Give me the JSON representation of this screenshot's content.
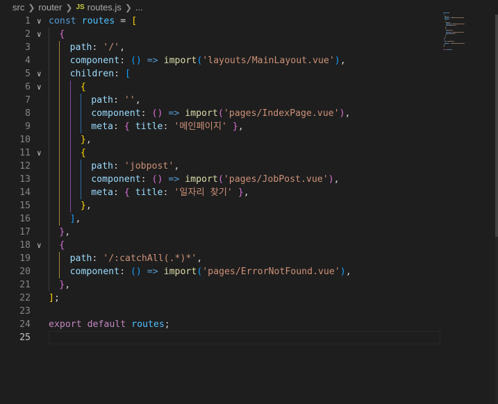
{
  "breadcrumb": {
    "parts": [
      "src",
      "router",
      "routes.js",
      "..."
    ],
    "file_icon": "JS"
  },
  "editor": {
    "language": "javascript",
    "current_line": 25,
    "folded_lines": [
      1,
      2,
      5,
      6,
      11,
      18
    ],
    "lines": [
      [
        [
          "kw",
          "const "
        ],
        [
          "var",
          "routes"
        ],
        [
          "op",
          " = "
        ],
        [
          "b1",
          "["
        ]
      ],
      [
        [
          "b2",
          "{"
        ]
      ],
      [
        [
          "prop",
          "path"
        ],
        [
          "op",
          ": "
        ],
        [
          "str",
          "'/'"
        ],
        [
          "op",
          ","
        ]
      ],
      [
        [
          "prop",
          "component"
        ],
        [
          "op",
          ": "
        ],
        [
          "b3",
          "()"
        ],
        [
          "op",
          " "
        ],
        [
          "kw",
          "=>"
        ],
        [
          "op",
          " "
        ],
        [
          "fn",
          "import"
        ],
        [
          "b3",
          "("
        ],
        [
          "str",
          "'layouts/MainLayout.vue'"
        ],
        [
          "b3",
          ")"
        ],
        [
          "op",
          ","
        ]
      ],
      [
        [
          "prop",
          "children"
        ],
        [
          "op",
          ": "
        ],
        [
          "b3",
          "["
        ]
      ],
      [
        [
          "b1",
          "{"
        ]
      ],
      [
        [
          "prop",
          "path"
        ],
        [
          "op",
          ": "
        ],
        [
          "str",
          "''"
        ],
        [
          "op",
          ","
        ]
      ],
      [
        [
          "prop",
          "component"
        ],
        [
          "op",
          ": "
        ],
        [
          "b2",
          "()"
        ],
        [
          "op",
          " "
        ],
        [
          "kw",
          "=>"
        ],
        [
          "op",
          " "
        ],
        [
          "fn",
          "import"
        ],
        [
          "b2",
          "("
        ],
        [
          "str",
          "'pages/IndexPage.vue'"
        ],
        [
          "b2",
          ")"
        ],
        [
          "op",
          ","
        ]
      ],
      [
        [
          "prop",
          "meta"
        ],
        [
          "op",
          ": "
        ],
        [
          "b2",
          "{"
        ],
        [
          "op",
          " "
        ],
        [
          "prop",
          "title"
        ],
        [
          "op",
          ": "
        ],
        [
          "str",
          "'메인페이지'"
        ],
        [
          "op",
          " "
        ],
        [
          "b2",
          "}"
        ],
        [
          "op",
          ","
        ]
      ],
      [
        [
          "b1",
          "}"
        ],
        [
          "op",
          ","
        ]
      ],
      [
        [
          "b1",
          "{"
        ]
      ],
      [
        [
          "prop",
          "path"
        ],
        [
          "op",
          ": "
        ],
        [
          "str",
          "'jobpost'"
        ],
        [
          "op",
          ","
        ]
      ],
      [
        [
          "prop",
          "component"
        ],
        [
          "op",
          ": "
        ],
        [
          "b2",
          "()"
        ],
        [
          "op",
          " "
        ],
        [
          "kw",
          "=>"
        ],
        [
          "op",
          " "
        ],
        [
          "fn",
          "import"
        ],
        [
          "b2",
          "("
        ],
        [
          "str",
          "'pages/JobPost.vue'"
        ],
        [
          "b2",
          ")"
        ],
        [
          "op",
          ","
        ]
      ],
      [
        [
          "prop",
          "meta"
        ],
        [
          "op",
          ": "
        ],
        [
          "b2",
          "{"
        ],
        [
          "op",
          " "
        ],
        [
          "prop",
          "title"
        ],
        [
          "op",
          ": "
        ],
        [
          "str",
          "'일자리 찾기'"
        ],
        [
          "op",
          " "
        ],
        [
          "b2",
          "}"
        ],
        [
          "op",
          ","
        ]
      ],
      [
        [
          "b1",
          "}"
        ],
        [
          "op",
          ","
        ]
      ],
      [
        [
          "b3",
          "]"
        ],
        [
          "op",
          ","
        ]
      ],
      [
        [
          "b2",
          "}"
        ],
        [
          "op",
          ","
        ]
      ],
      [
        [
          "b2",
          "{"
        ]
      ],
      [
        [
          "prop",
          "path"
        ],
        [
          "op",
          ": "
        ],
        [
          "str",
          "'/:catchAll(.*)*'"
        ],
        [
          "op",
          ","
        ]
      ],
      [
        [
          "prop",
          "component"
        ],
        [
          "op",
          ": "
        ],
        [
          "b3",
          "()"
        ],
        [
          "op",
          " "
        ],
        [
          "kw",
          "=>"
        ],
        [
          "op",
          " "
        ],
        [
          "fn",
          "import"
        ],
        [
          "b3",
          "("
        ],
        [
          "str",
          "'pages/ErrorNotFound.vue'"
        ],
        [
          "b3",
          ")"
        ],
        [
          "op",
          ","
        ]
      ],
      [
        [
          "b2",
          "}"
        ],
        [
          "op",
          ","
        ]
      ],
      [
        [
          "b1",
          "]"
        ],
        [
          "op",
          ";"
        ]
      ],
      [],
      [
        [
          "ctl",
          "export"
        ],
        [
          "op",
          " "
        ],
        [
          "ctl",
          "default"
        ],
        [
          "op",
          " "
        ],
        [
          "var",
          "routes"
        ],
        [
          "op",
          ";"
        ]
      ],
      []
    ]
  },
  "colors": {
    "background": "#1e1e1e",
    "line_number": "#858585",
    "line_number_active": "#c6c6c6",
    "indent_guide_level1": "#3b3b3b",
    "indent_guide_level2": "#a88a3a",
    "indent_guide_level3": "#8a4aa0",
    "indent_guide_level4": "#2e6fa8"
  },
  "icons": {
    "breadcrumb_separator": "chevron-right-icon",
    "fold": "chevron-down-icon",
    "file": "javascript-file-icon"
  }
}
